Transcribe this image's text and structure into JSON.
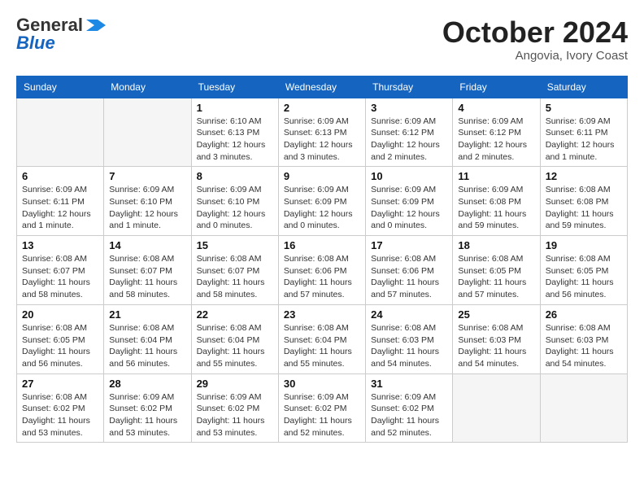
{
  "header": {
    "logo_general": "General",
    "logo_blue": "Blue",
    "month_title": "October 2024",
    "location": "Angovia, Ivory Coast"
  },
  "days_of_week": [
    "Sunday",
    "Monday",
    "Tuesday",
    "Wednesday",
    "Thursday",
    "Friday",
    "Saturday"
  ],
  "weeks": [
    [
      {
        "day": "",
        "info": ""
      },
      {
        "day": "",
        "info": ""
      },
      {
        "day": "1",
        "info": "Sunrise: 6:10 AM\nSunset: 6:13 PM\nDaylight: 12 hours and 3 minutes."
      },
      {
        "day": "2",
        "info": "Sunrise: 6:09 AM\nSunset: 6:13 PM\nDaylight: 12 hours and 3 minutes."
      },
      {
        "day": "3",
        "info": "Sunrise: 6:09 AM\nSunset: 6:12 PM\nDaylight: 12 hours and 2 minutes."
      },
      {
        "day": "4",
        "info": "Sunrise: 6:09 AM\nSunset: 6:12 PM\nDaylight: 12 hours and 2 minutes."
      },
      {
        "day": "5",
        "info": "Sunrise: 6:09 AM\nSunset: 6:11 PM\nDaylight: 12 hours and 1 minute."
      }
    ],
    [
      {
        "day": "6",
        "info": "Sunrise: 6:09 AM\nSunset: 6:11 PM\nDaylight: 12 hours and 1 minute."
      },
      {
        "day": "7",
        "info": "Sunrise: 6:09 AM\nSunset: 6:10 PM\nDaylight: 12 hours and 1 minute."
      },
      {
        "day": "8",
        "info": "Sunrise: 6:09 AM\nSunset: 6:10 PM\nDaylight: 12 hours and 0 minutes."
      },
      {
        "day": "9",
        "info": "Sunrise: 6:09 AM\nSunset: 6:09 PM\nDaylight: 12 hours and 0 minutes."
      },
      {
        "day": "10",
        "info": "Sunrise: 6:09 AM\nSunset: 6:09 PM\nDaylight: 12 hours and 0 minutes."
      },
      {
        "day": "11",
        "info": "Sunrise: 6:09 AM\nSunset: 6:08 PM\nDaylight: 11 hours and 59 minutes."
      },
      {
        "day": "12",
        "info": "Sunrise: 6:08 AM\nSunset: 6:08 PM\nDaylight: 11 hours and 59 minutes."
      }
    ],
    [
      {
        "day": "13",
        "info": "Sunrise: 6:08 AM\nSunset: 6:07 PM\nDaylight: 11 hours and 58 minutes."
      },
      {
        "day": "14",
        "info": "Sunrise: 6:08 AM\nSunset: 6:07 PM\nDaylight: 11 hours and 58 minutes."
      },
      {
        "day": "15",
        "info": "Sunrise: 6:08 AM\nSunset: 6:07 PM\nDaylight: 11 hours and 58 minutes."
      },
      {
        "day": "16",
        "info": "Sunrise: 6:08 AM\nSunset: 6:06 PM\nDaylight: 11 hours and 57 minutes."
      },
      {
        "day": "17",
        "info": "Sunrise: 6:08 AM\nSunset: 6:06 PM\nDaylight: 11 hours and 57 minutes."
      },
      {
        "day": "18",
        "info": "Sunrise: 6:08 AM\nSunset: 6:05 PM\nDaylight: 11 hours and 57 minutes."
      },
      {
        "day": "19",
        "info": "Sunrise: 6:08 AM\nSunset: 6:05 PM\nDaylight: 11 hours and 56 minutes."
      }
    ],
    [
      {
        "day": "20",
        "info": "Sunrise: 6:08 AM\nSunset: 6:05 PM\nDaylight: 11 hours and 56 minutes."
      },
      {
        "day": "21",
        "info": "Sunrise: 6:08 AM\nSunset: 6:04 PM\nDaylight: 11 hours and 56 minutes."
      },
      {
        "day": "22",
        "info": "Sunrise: 6:08 AM\nSunset: 6:04 PM\nDaylight: 11 hours and 55 minutes."
      },
      {
        "day": "23",
        "info": "Sunrise: 6:08 AM\nSunset: 6:04 PM\nDaylight: 11 hours and 55 minutes."
      },
      {
        "day": "24",
        "info": "Sunrise: 6:08 AM\nSunset: 6:03 PM\nDaylight: 11 hours and 54 minutes."
      },
      {
        "day": "25",
        "info": "Sunrise: 6:08 AM\nSunset: 6:03 PM\nDaylight: 11 hours and 54 minutes."
      },
      {
        "day": "26",
        "info": "Sunrise: 6:08 AM\nSunset: 6:03 PM\nDaylight: 11 hours and 54 minutes."
      }
    ],
    [
      {
        "day": "27",
        "info": "Sunrise: 6:08 AM\nSunset: 6:02 PM\nDaylight: 11 hours and 53 minutes."
      },
      {
        "day": "28",
        "info": "Sunrise: 6:09 AM\nSunset: 6:02 PM\nDaylight: 11 hours and 53 minutes."
      },
      {
        "day": "29",
        "info": "Sunrise: 6:09 AM\nSunset: 6:02 PM\nDaylight: 11 hours and 53 minutes."
      },
      {
        "day": "30",
        "info": "Sunrise: 6:09 AM\nSunset: 6:02 PM\nDaylight: 11 hours and 52 minutes."
      },
      {
        "day": "31",
        "info": "Sunrise: 6:09 AM\nSunset: 6:02 PM\nDaylight: 11 hours and 52 minutes."
      },
      {
        "day": "",
        "info": ""
      },
      {
        "day": "",
        "info": ""
      }
    ]
  ]
}
